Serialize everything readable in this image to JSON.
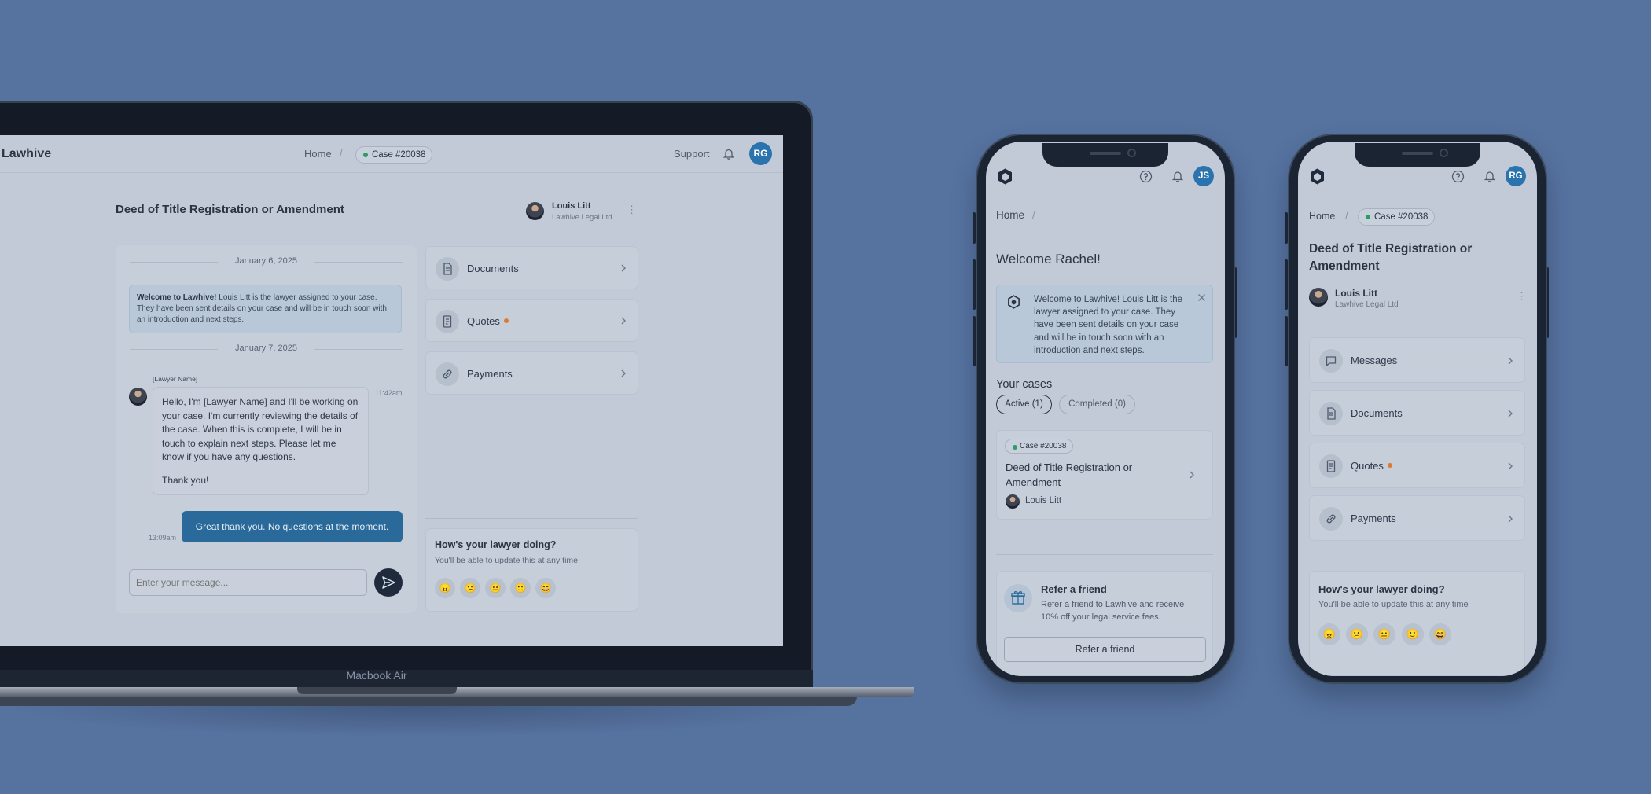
{
  "laptop": {
    "model_label": "Macbook Air",
    "header": {
      "brand": "Lawhive",
      "breadcrumb_home": "Home",
      "breadcrumb_sep": "/",
      "case_badge": "Case #20038",
      "support": "Support",
      "avatar_initials": "RG"
    },
    "case_title": "Deed of Title Registration or Amendment",
    "lawyer": {
      "name": "Louis Litt",
      "firm": "Lawhive Legal Ltd"
    },
    "chat": {
      "date_1": "January 6, 2025",
      "welcome_bold": "Welcome to Lawhive!",
      "welcome_text": " Louis Litt is the lawyer assigned to your case. They have been sent details on your case and will be in touch soon with an introduction and next steps.",
      "date_2": "January 7, 2025",
      "lawyer_tag": "[Lawyer Name]",
      "lawyer_message": "Hello, I'm [Lawyer Name] and I'll be working on your case. I'm currently reviewing the details of the case. When this is complete, I will be in touch to explain next steps. Please let me know if you have any questions.",
      "lawyer_signoff": "Thank you!",
      "lawyer_time": "11:42am",
      "my_message": "Great thank you. No questions at the moment.",
      "my_time": "13:09am",
      "input_placeholder": "Enter your message..."
    },
    "side_menu": [
      {
        "label": "Documents"
      },
      {
        "label": "Quotes"
      },
      {
        "label": "Payments"
      }
    ],
    "rating": {
      "question": "How's your lawyer doing?",
      "subtitle": "You'll be able to update this at any time",
      "emojis": [
        "😠",
        "😕",
        "😐",
        "🙂",
        "😄"
      ]
    }
  },
  "phone_home": {
    "avatar_initials": "JS",
    "breadcrumb_home": "Home",
    "breadcrumb_sep": "/",
    "welcome_title": "Welcome Rachel!",
    "notice_text": "Welcome to Lawhive! Louis Litt is the lawyer assigned to your case. They have been sent details on your case and will be in touch soon with an introduction and next steps.",
    "cases_heading": "Your cases",
    "tab_active": "Active (1)",
    "tab_completed": "Completed (0)",
    "case": {
      "badge": "Case #20038",
      "title": "Deed of Title Registration or Amendment",
      "lawyer": "Louis Litt"
    },
    "refer": {
      "title": "Refer a friend",
      "text": "Refer a friend to Lawhive and receive 10% off your legal service fees.",
      "button": "Refer a friend"
    }
  },
  "phone_case": {
    "avatar_initials": "RG",
    "breadcrumb_home": "Home",
    "breadcrumb_sep": "/",
    "case_badge": "Case #20038",
    "case_title": "Deed of Title Registration or Amendment",
    "lawyer": {
      "name": "Louis Litt",
      "firm": "Lawhive Legal Ltd"
    },
    "menu": [
      {
        "label": "Messages"
      },
      {
        "label": "Documents"
      },
      {
        "label": "Quotes"
      },
      {
        "label": "Payments"
      }
    ],
    "rating": {
      "question": "How's your lawyer doing?",
      "subtitle": "You'll be able to update this at any time",
      "emojis": [
        "😠",
        "😕",
        "😐",
        "🙂",
        "😄"
      ]
    }
  },
  "colors": {
    "background": "#56729f",
    "screen": "#c2cad7",
    "accent": "#2a73ad",
    "status_green": "#2e9a64",
    "notify_orange": "#e07a2e"
  }
}
